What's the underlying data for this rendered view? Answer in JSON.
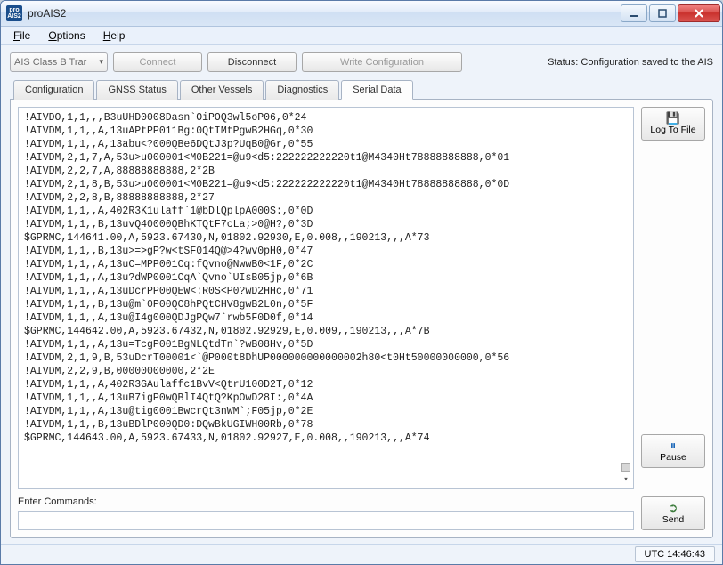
{
  "window": {
    "title": "proAIS2"
  },
  "menu": {
    "file": "File",
    "options": "Options",
    "help": "Help"
  },
  "toolbar": {
    "device_combo": "AIS Class B Trar",
    "connect": "Connect",
    "disconnect": "Disconnect",
    "write_config": "Write Configuration"
  },
  "status": "Status: Configuration saved to the AIS",
  "tabs": {
    "items": [
      {
        "label": "Configuration"
      },
      {
        "label": "GNSS Status"
      },
      {
        "label": "Other Vessels"
      },
      {
        "label": "Diagnostics"
      },
      {
        "label": "Serial Data"
      }
    ],
    "active_index": 4
  },
  "serial_lines": [
    "!AIVDO,1,1,,,B3uUHD0008Dasn`OiPOQ3wl5oP06,0*24",
    "!AIVDM,1,1,,A,13uAPtPP011Bg:0QtIMtPgwB2HGq,0*30",
    "!AIVDM,1,1,,A,13abu<?000QBe6DQtJ3p?UqB0@Gr,0*55",
    "!AIVDM,2,1,7,A,53u>u000001<M0B221=@u9<d5:222222222220t1@M4340Ht78888888888,0*01",
    "!AIVDM,2,2,7,A,88888888888,2*2B",
    "!AIVDM,2,1,8,B,53u>u000001<M0B221=@u9<d5:222222222220t1@M4340Ht78888888888,0*0D",
    "!AIVDM,2,2,8,B,88888888888,2*27",
    "!AIVDM,1,1,,A,402R3K1ulaff`1@bDlQplpA000S:,0*0D",
    "!AIVDM,1,1,,B,13uvQ40000QBhKTQtF7cLa;>0@H?,0*3D",
    "$GPRMC,144641.00,A,5923.67430,N,01802.92930,E,0.008,,190213,,,A*73",
    "!AIVDM,1,1,,B,13u>=>gP?w<tSF014Q@>4?wv0pH0,0*47",
    "!AIVDM,1,1,,A,13uC=MPP001Cq:fQvno@NwwB0<1F,0*2C",
    "!AIVDM,1,1,,A,13u?dWP0001CqA`Qvno`UIsB05jp,0*6B",
    "!AIVDM,1,1,,A,13uDcrPP00QEW<:R0S<P0?wD2HHc,0*71",
    "!AIVDM,1,1,,B,13u@m`0P00QC8hPQtCHV8gwB2L0n,0*5F",
    "!AIVDM,1,1,,A,13u@I4g000QDJgPQw7`rwb5F0D0f,0*14",
    "$GPRMC,144642.00,A,5923.67432,N,01802.92929,E,0.009,,190213,,,A*7B",
    "!AIVDM,1,1,,A,13u=TcgP001BgNLQtdTn`?wB08Hv,0*5D",
    "!AIVDM,2,1,9,B,53uDcrT00001<`@P000t8DhUP000000000000002h80<t0Ht50000000000,0*56",
    "!AIVDM,2,2,9,B,00000000000,2*2E",
    "!AIVDM,1,1,,A,402R3GAulaffc1BvV<QtrU100D2T,0*12",
    "!AIVDM,1,1,,A,13uB7igP0wQBlI4QtQ?KpOwD28I:,0*4A",
    "!AIVDM,1,1,,A,13u@tig0001BwcrQt3nWM`;F05jp,0*2E",
    "!AIVDM,1,1,,B,13uBDlP000QD0:DQwBkUGIWH00Rb,0*78",
    "$GPRMC,144643.00,A,5923.67433,N,01802.92927,E,0.008,,190213,,,A*74"
  ],
  "side": {
    "log_to_file": "Log To File",
    "pause": "Pause",
    "send": "Send"
  },
  "commands": {
    "label": "Enter Commands:",
    "value": ""
  },
  "statusbar": {
    "utc": "UTC 14:46:43"
  },
  "icons": {
    "save": "💾",
    "pause": "⏸",
    "send": "➲"
  }
}
